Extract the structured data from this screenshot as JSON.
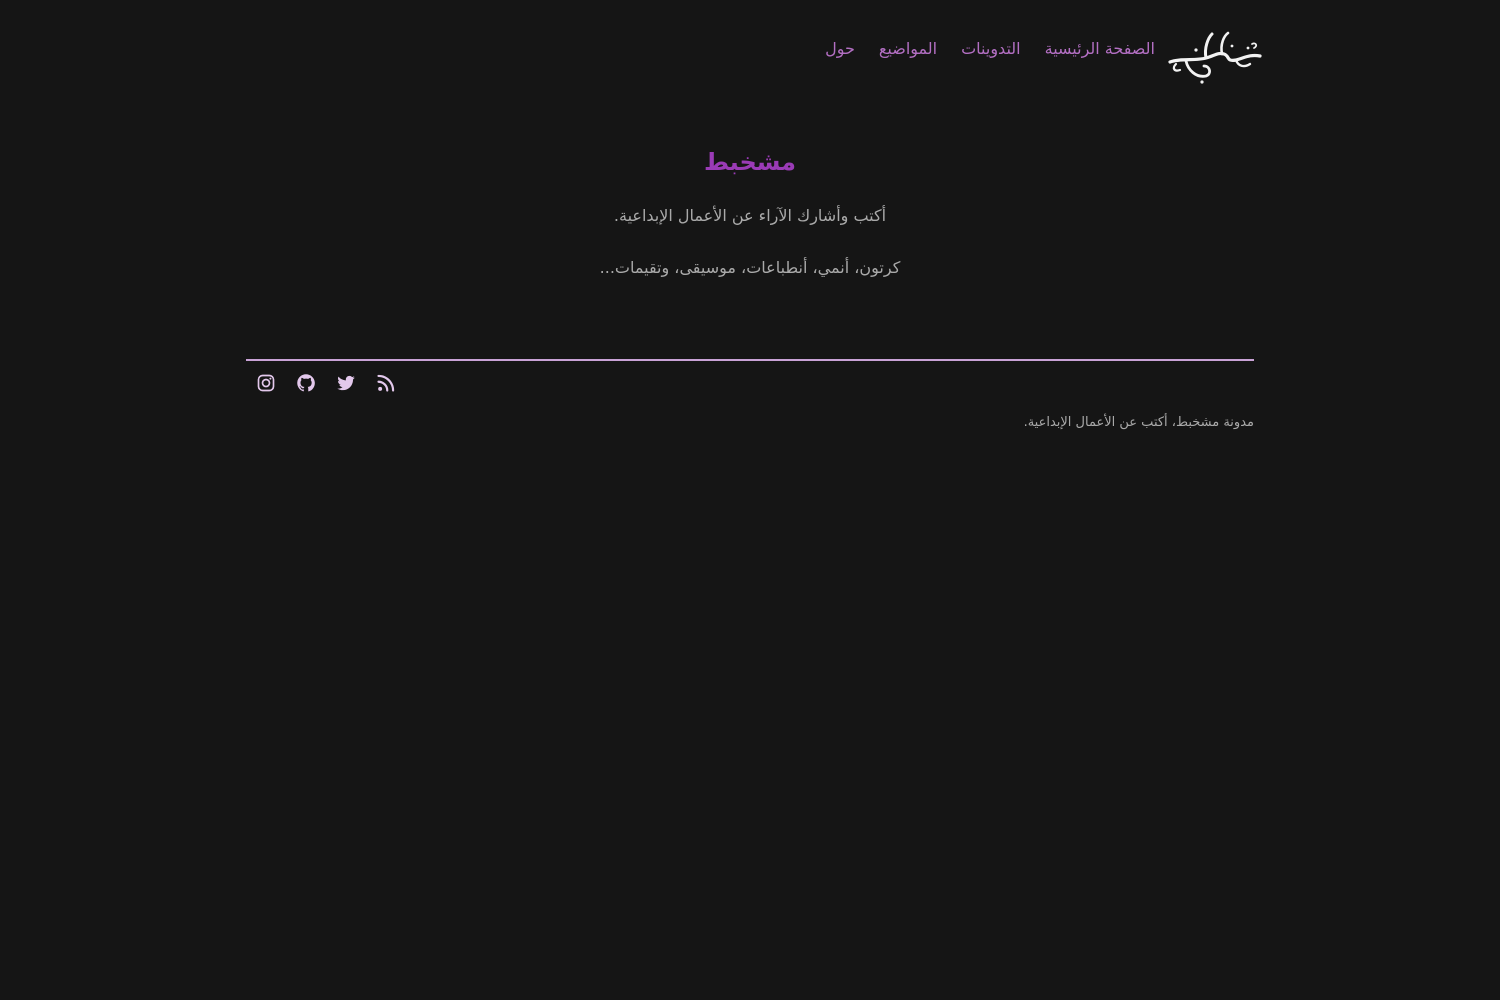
{
  "header": {
    "logo_alt": "مشخبط",
    "nav": [
      {
        "label": "الصفحة الرئيسية"
      },
      {
        "label": "التدوينات"
      },
      {
        "label": "المواضيع"
      },
      {
        "label": "حول"
      }
    ]
  },
  "hero": {
    "title": "مشخبط",
    "lines": [
      "أكتب وأشارك الآراء عن الأعمال الإبداعية.",
      "كرتون، أنمي، أنطباعات، موسيقى، وتقيمات..."
    ]
  },
  "footer": {
    "social_icons": [
      "instagram-icon",
      "github-icon",
      "twitter-icon",
      "rss-icon"
    ],
    "copyright": "مدونة مشخبط، أكتب عن الأعمال الإبداعية."
  },
  "colors": {
    "background": "#151515",
    "nav_link": "#b36fc3",
    "title": "#9a3bb6",
    "text": "#a9a9a9",
    "divider": "#c9a2d6",
    "icon": "#e3c8ec"
  }
}
